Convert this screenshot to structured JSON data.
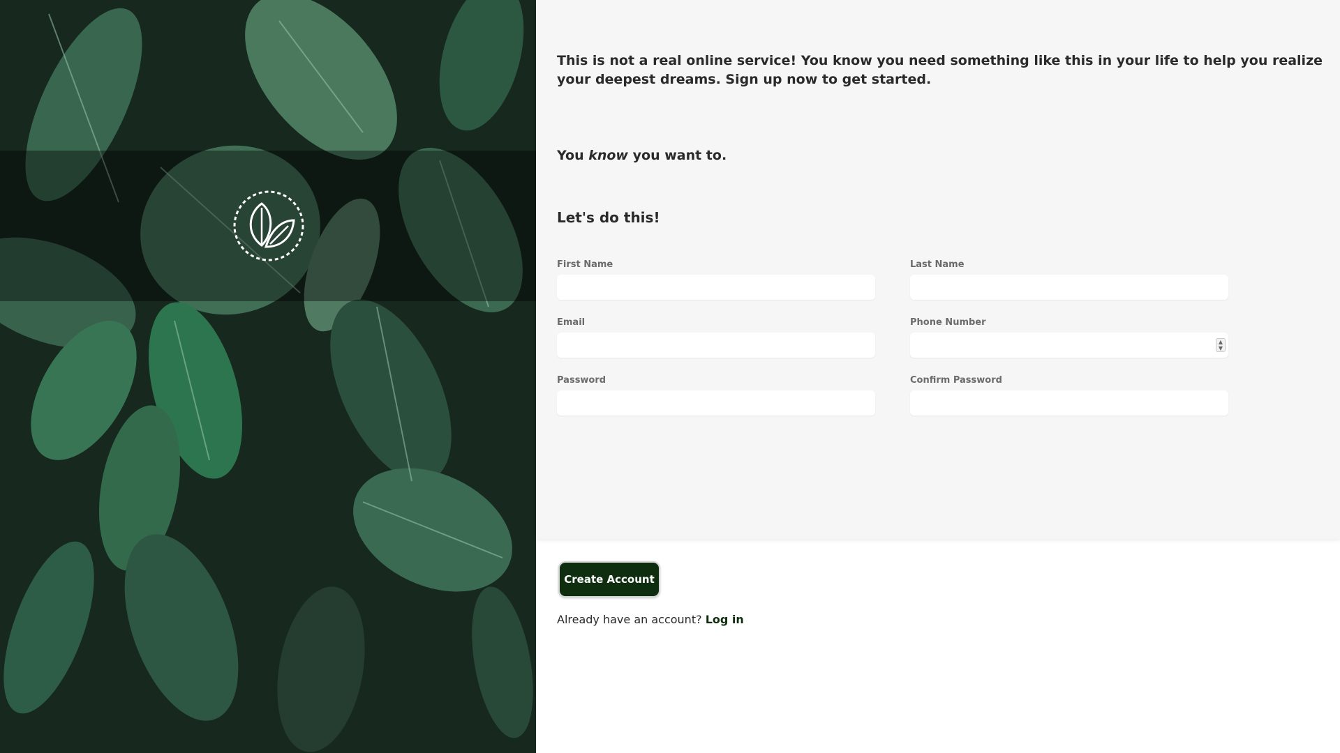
{
  "hero": {
    "logo_icon": "leaf-circle-logo-icon",
    "background": "dark green leaves photo"
  },
  "intro": {
    "text": "This is not a real online service! You know you need something like this in your life to help you realize your deepest dreams. Sign up now to get started."
  },
  "tagline": {
    "prefix": "You",
    "emphasis": "know",
    "suffix": "you want to."
  },
  "cta_title": "Let's do this!",
  "form": {
    "first_name": {
      "label": "First Name",
      "value": ""
    },
    "last_name": {
      "label": "Last Name",
      "value": ""
    },
    "email": {
      "label": "Email",
      "value": ""
    },
    "phone": {
      "label": "Phone Number",
      "value": ""
    },
    "password": {
      "label": "Password",
      "value": ""
    },
    "confirm_password": {
      "label": "Confirm Password",
      "value": ""
    }
  },
  "actions": {
    "create_account": "Create Account",
    "login_prompt": "Already have an account?",
    "login_link": "Log in"
  },
  "colors": {
    "accent": "#0f2e0f",
    "panel_bg": "#f6f6f6",
    "label": "#6b6b6b"
  }
}
